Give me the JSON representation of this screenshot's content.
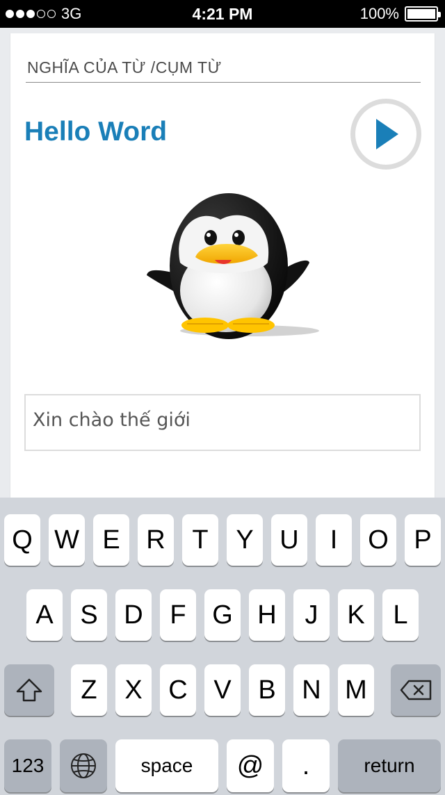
{
  "status": {
    "signal_bars": 3,
    "signal_total": 5,
    "carrier": "3G",
    "time": "4:21 PM",
    "battery": "100%",
    "battery_level": 1.0
  },
  "app": {
    "section_label": "NGHĨA CỦA TỪ /CỤM TỪ",
    "word": "Hello Word",
    "answer": "Xin chào thế giới",
    "play_icon": "play-icon",
    "image": "penguin-illustration",
    "accent_color": "#1a7fb8"
  },
  "keyboard": {
    "row1": [
      "Q",
      "W",
      "E",
      "R",
      "T",
      "Y",
      "U",
      "I",
      "O",
      "P"
    ],
    "row2": [
      "A",
      "S",
      "D",
      "F",
      "G",
      "H",
      "J",
      "K",
      "L"
    ],
    "row3": [
      "Z",
      "X",
      "C",
      "V",
      "B",
      "N",
      "M"
    ],
    "shift_icon": "shift-icon",
    "delete_icon": "delete-icon",
    "globe_icon": "globe-icon",
    "numbers": "123",
    "space": "space",
    "at": "@",
    "period": ".",
    "return": "return"
  }
}
